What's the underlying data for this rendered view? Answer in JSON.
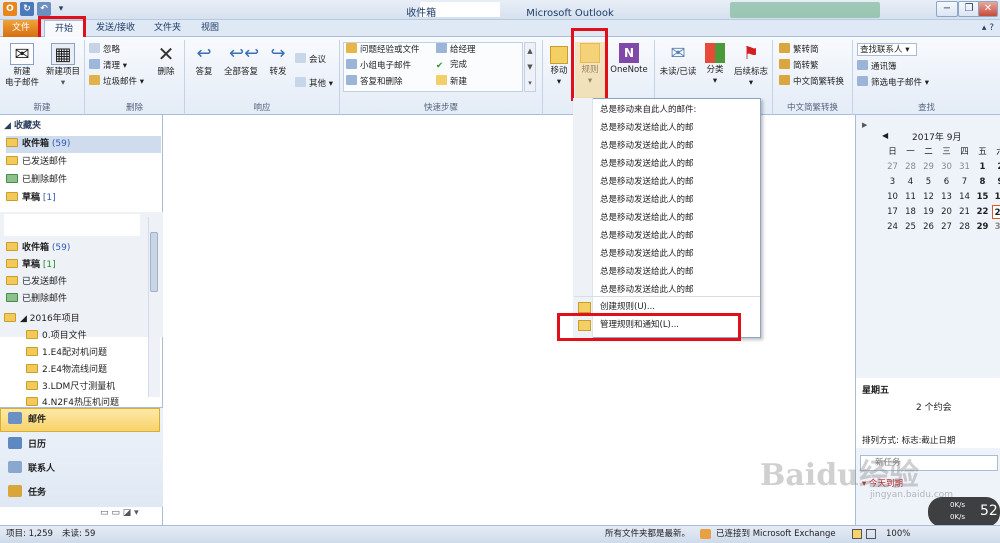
{
  "window": {
    "title": "收件箱",
    "app": "Microsoft Outlook"
  },
  "tabs": [
    "文件",
    "开始",
    "发送/接收",
    "文件夹",
    "视图"
  ],
  "ribbon": {
    "new": {
      "new_mail": "新建\n电子邮件",
      "new_items": "新建项目",
      "label": "新建"
    },
    "delete": {
      "ignore": "忽略",
      "cleanup": "清理 ▾",
      "junk": "垃圾邮件 ▾",
      "delete": "删除",
      "label": "删除"
    },
    "respond": {
      "reply": "答复",
      "reply_all": "全部答复",
      "forward": "转发",
      "meeting": "会议",
      "more": "其他 ▾",
      "label": "响应"
    },
    "quicksteps": {
      "items": [
        "问题经验或文件",
        "给经理",
        "小组电子邮件",
        "完成",
        "答复和删除",
        "新建"
      ],
      "label": "快速步骤"
    },
    "move": {
      "move": "移动",
      "rules": "规则",
      "onenote": "OneNote"
    },
    "tags": {
      "unread": "未读/已读",
      "categorize": "分类",
      "followup": "后续标志"
    },
    "chinese": {
      "to_trad": "繁转简",
      "to_simp": "简转繁",
      "convert": "中文简繁转换",
      "label": "中文简繁转换"
    },
    "find": {
      "contact": "查找联系人",
      "address": "通讯簿",
      "filter": "筛选电子邮件 ▾",
      "label": "查找"
    }
  },
  "nav": {
    "favorites": "◢ 收藏夹",
    "fav_items": [
      {
        "label": "收件箱",
        "count": "(59)"
      },
      {
        "label": "已发送邮件",
        "count": ""
      },
      {
        "label": "已删除邮件",
        "count": ""
      },
      {
        "label": "草稿",
        "count": "[1]"
      }
    ],
    "account_items": [
      {
        "label": "收件箱",
        "count": "(59)"
      },
      {
        "label": "草稿",
        "count": "[1]"
      },
      {
        "label": "已发送邮件",
        "count": ""
      },
      {
        "label": "已删除邮件",
        "count": ""
      }
    ],
    "project": "◢ 2016年项目",
    "project_items": [
      "0.项目文件",
      "1.E4配对机问题",
      "2.E4物流线问题",
      "3.LDM尺寸测量机",
      "4.N2F4热压机问题"
    ],
    "big": [
      "邮件",
      "日历",
      "联系人",
      "任务"
    ]
  },
  "rules_menu": {
    "items": [
      "总是移动来自此人的邮件:",
      "总是移动发送给此人的邮",
      "总是移动发送给此人的邮",
      "总是移动发送给此人的邮",
      "总是移动发送给此人的邮",
      "总是移动发送给此人的邮",
      "总是移动发送给此人的邮",
      "总是移动发送给此人的邮",
      "总是移动发送给此人的邮",
      "总是移动发送给此人的邮",
      "总是移动发送给此人的邮"
    ],
    "create": "创建规则(U)...",
    "manage": "管理规则和通知(L)..."
  },
  "calendar": {
    "month": "2017年 9月",
    "weekdays": [
      "日",
      "一",
      "二",
      "三",
      "四",
      "五",
      "六"
    ],
    "rows": [
      [
        "27",
        "28",
        "29",
        "30",
        "31",
        "1",
        "2"
      ],
      [
        "3",
        "4",
        "5",
        "6",
        "7",
        "8",
        "9"
      ],
      [
        "10",
        "11",
        "12",
        "13",
        "14",
        "15",
        "16"
      ],
      [
        "17",
        "18",
        "19",
        "20",
        "21",
        "22",
        "23"
      ],
      [
        "24",
        "25",
        "26",
        "27",
        "28",
        "29",
        "30"
      ]
    ],
    "today": "23"
  },
  "todo": {
    "day": "星期五",
    "appointments": "2 个约会",
    "arrange": "排列方式: 标志:截止日期",
    "new_task": "新任务",
    "today": "今天到期"
  },
  "status": {
    "items": "项目: 1,259",
    "unread": "未读: 59",
    "sync": "所有文件夹都是最新。",
    "exchange": "已连接到 Microsoft Exchange",
    "zoom": "100%"
  },
  "net": {
    "up": "0K/s",
    "down": "0K/s",
    "num": "52"
  },
  "watermark": {
    "logo": "Baidu经验",
    "url": "jingyan.baidu.com"
  }
}
